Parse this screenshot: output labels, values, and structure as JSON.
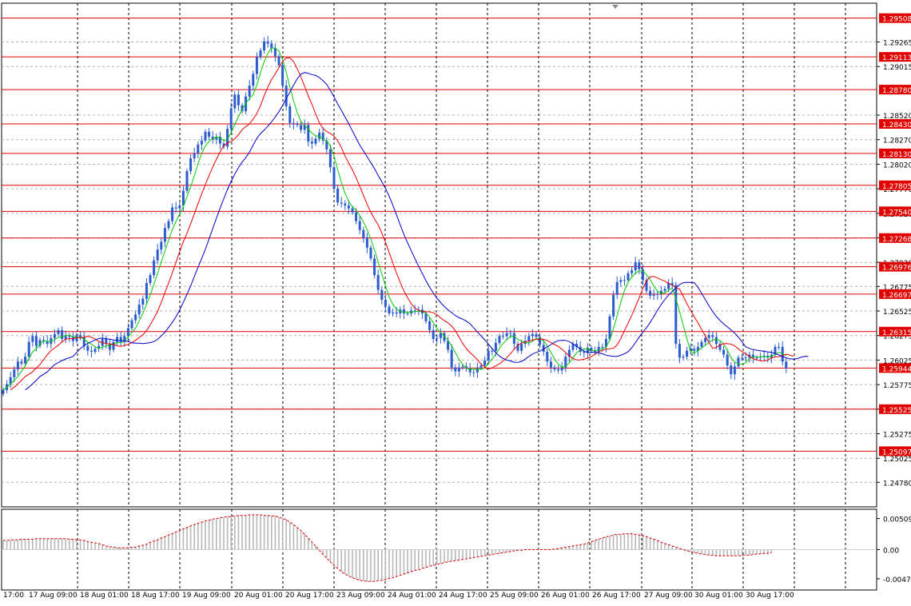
{
  "chart_data": {
    "type": "candlestick",
    "colors": {
      "background": "#ffffff",
      "grid": "#b0b0b0",
      "candle": "#2b5ccf",
      "level_line": "#e00000",
      "level_label_bg": "#e00000",
      "level_label_text": "#ffffff",
      "ma_fast": "#00cc00",
      "ma_mid": "#ee0000",
      "ma_slow": "#0000cc",
      "osc_hist": "#b8b8b8",
      "osc_signal": "#dd0000"
    },
    "price_axis": {
      "ylim": [
        1.2453,
        1.2966
      ],
      "ticks": [
        "1.29265",
        "1.29015",
        "1.28520",
        "1.28270",
        "1.28020",
        "1.27770",
        "1.27520",
        "1.27270",
        "1.27020",
        "1.26775",
        "1.26525",
        "1.26275",
        "1.26025",
        "1.25775",
        "1.25525",
        "1.25275",
        "1.25025",
        "1.24780"
      ]
    },
    "levels": [
      "1.29508",
      "1.29113",
      "1.28780",
      "1.28430",
      "1.28130",
      "1.27805",
      "1.27540",
      "1.27268",
      "1.26976",
      "1.26697",
      "1.26315",
      "1.25944",
      "1.25525",
      "1.25097"
    ],
    "time_axis": {
      "labels": [
        "17:00",
        "17 Aug 09:00",
        "18 Aug 01:00",
        "18 Aug 17:00",
        "19 Aug 09:00",
        "20 Aug 01:00",
        "20 Aug 17:00",
        "23 Aug 09:00",
        "24 Aug 01:00",
        "24 Aug 17:00",
        "25 Aug 09:00",
        "26 Aug 01:00",
        "26 Aug 17:00",
        "27 Aug 09:00",
        "30 Aug 01:00",
        "30 Aug 17:00"
      ]
    },
    "series": [
      {
        "name": "price",
        "close": [
          1.2572,
          1.2578,
          1.2585,
          1.2593,
          1.2601,
          1.2599,
          1.2606,
          1.2621,
          1.2627,
          1.2617,
          1.2623,
          1.2622,
          1.2619,
          1.2625,
          1.2629,
          1.2633,
          1.2624,
          1.2627,
          1.2626,
          1.2622,
          1.2628,
          1.2626,
          1.2617,
          1.2612,
          1.2611,
          1.2614,
          1.2617,
          1.2624,
          1.2619,
          1.2613,
          1.2621,
          1.2626,
          1.2621,
          1.2627,
          1.2635,
          1.2643,
          1.2649,
          1.2659,
          1.2665,
          1.2681,
          1.2689,
          1.2704,
          1.2715,
          1.2723,
          1.2737,
          1.2744,
          1.2758,
          1.2757,
          1.276,
          1.2775,
          1.2795,
          1.2808,
          1.2813,
          1.2822,
          1.2826,
          1.2835,
          1.283,
          1.2827,
          1.283,
          1.2823,
          1.282,
          1.2838,
          1.2859,
          1.2873,
          1.2862,
          1.2856,
          1.2871,
          1.2882,
          1.2894,
          1.2911,
          1.2918,
          1.2927,
          1.2925,
          1.292,
          1.2912,
          1.2903,
          1.2882,
          1.2861,
          1.2844,
          1.2843,
          1.2842,
          1.2837,
          1.2842,
          1.2825,
          1.2823,
          1.2828,
          1.2834,
          1.2826,
          1.2817,
          1.2799,
          1.2777,
          1.2763,
          1.2762,
          1.276,
          1.2757,
          1.2753,
          1.2744,
          1.2735,
          1.2727,
          1.2717,
          1.2706,
          1.2689,
          1.2674,
          1.2664,
          1.2657,
          1.265,
          1.2651,
          1.265,
          1.2654,
          1.265,
          1.265,
          1.2653,
          1.2653,
          1.2654,
          1.265,
          1.2642,
          1.2633,
          1.2624,
          1.2625,
          1.263,
          1.2622,
          1.2613,
          1.2595,
          1.2591,
          1.2595,
          1.2596,
          1.2594,
          1.259,
          1.259,
          1.2595,
          1.2597,
          1.2602,
          1.2612,
          1.2612,
          1.262,
          1.2627,
          1.2627,
          1.263,
          1.263,
          1.2619,
          1.2612,
          1.2619,
          1.2622,
          1.2627,
          1.2629,
          1.2626,
          1.2618,
          1.2611,
          1.2601,
          1.2595,
          1.2593,
          1.2592,
          1.2595,
          1.2606,
          1.2613,
          1.2619,
          1.2616,
          1.2611,
          1.261,
          1.2615,
          1.2612,
          1.2611,
          1.2616,
          1.2616,
          1.2624,
          1.2647,
          1.2669,
          1.2682,
          1.2684,
          1.2684,
          1.2691,
          1.2694,
          1.2702,
          1.2695,
          1.2684,
          1.2673,
          1.2668,
          1.2669,
          1.267,
          1.2673,
          1.2675,
          1.2681,
          1.2679,
          1.2619,
          1.2605,
          1.2606,
          1.2612,
          1.2614,
          1.2612,
          1.2616,
          1.2621,
          1.2625,
          1.2628,
          1.2626,
          1.2619,
          1.2613,
          1.2608,
          1.2597,
          1.2588,
          1.2596,
          1.2605,
          1.2605,
          1.2605,
          1.2608,
          1.2605,
          1.2605,
          1.2606,
          1.2607,
          1.2605,
          1.2608,
          1.2616,
          1.2616,
          1.2601,
          1.2594
        ]
      },
      {
        "name": "ma_fast"
      },
      {
        "name": "ma_mid"
      },
      {
        "name": "ma_slow"
      }
    ],
    "oscillator": {
      "ylim": [
        -0.0066,
        0.0066
      ],
      "ticks": [
        "0.00509",
        "0.00",
        "-0.00476"
      ],
      "values": [
        0.0015,
        0.0015,
        0.0016,
        0.0016,
        0.0016,
        0.0017,
        0.0017,
        0.0017,
        0.0017,
        0.0018,
        0.0018,
        0.0018,
        0.0018,
        0.0018,
        0.0018,
        0.0018,
        0.0018,
        0.0018,
        0.0017,
        0.0017,
        0.0016,
        0.0016,
        0.0015,
        0.0013,
        0.0012,
        0.0011,
        0.001,
        0.0008,
        0.0006,
        0.0005,
        0.0004,
        0.0003,
        0.0003,
        0.0003,
        0.0003,
        0.0004,
        0.0004,
        0.0006,
        0.0007,
        0.0009,
        0.0012,
        0.0014,
        0.0016,
        0.0019,
        0.0021,
        0.0024,
        0.0026,
        0.0029,
        0.0031,
        0.0034,
        0.0036,
        0.0039,
        0.0041,
        0.0043,
        0.0045,
        0.0047,
        0.0048,
        0.005,
        0.0051,
        0.0052,
        0.0053,
        0.0054,
        0.0054,
        0.0055,
        0.0056,
        0.0056,
        0.0056,
        0.0057,
        0.0057,
        0.0057,
        0.0057,
        0.0056,
        0.0056,
        0.0055,
        0.0055,
        0.0053,
        0.0051,
        0.0049,
        0.0045,
        0.0041,
        0.0036,
        0.0031,
        0.0025,
        0.0019,
        0.0012,
        0.0006,
        -0.0001,
        -0.0008,
        -0.0014,
        -0.002,
        -0.0026,
        -0.0031,
        -0.0036,
        -0.004,
        -0.0043,
        -0.0046,
        -0.0048,
        -0.005,
        -0.0051,
        -0.0052,
        -0.0052,
        -0.0052,
        -0.0051,
        -0.005,
        -0.0049,
        -0.0047,
        -0.0046,
        -0.0044,
        -0.0042,
        -0.004,
        -0.0038,
        -0.0036,
        -0.0034,
        -0.0033,
        -0.0031,
        -0.0029,
        -0.0027,
        -0.0026,
        -0.0024,
        -0.0023,
        -0.0021,
        -0.002,
        -0.0019,
        -0.0018,
        -0.0017,
        -0.0016,
        -0.0015,
        -0.0014,
        -0.0013,
        -0.0012,
        -0.0011,
        -0.001,
        -0.0009,
        -0.0008,
        -0.0007,
        -0.0006,
        -0.0005,
        -0.0004,
        -0.0003,
        -0.0002,
        -0.0001,
        -0.0001,
        0.0,
        0.0,
        0.0,
        0.0,
        0.0,
        0.0,
        0.0,
        0.0,
        0.0001,
        0.0002,
        0.0003,
        0.0004,
        0.0005,
        0.0006,
        0.0007,
        0.0008,
        0.0009,
        0.0011,
        0.0013,
        0.0015,
        0.0017,
        0.0019,
        0.0021,
        0.0022,
        0.0024,
        0.0025,
        0.0025,
        0.0026,
        0.0026,
        0.0026,
        0.0025,
        0.0024,
        0.0023,
        0.0021,
        0.0019,
        0.0017,
        0.0015,
        0.0012,
        0.001,
        0.0008,
        0.0006,
        0.0004,
        0.0002,
        0.0,
        -0.0002,
        -0.0003,
        -0.0005,
        -0.0006,
        -0.0007,
        -0.0008,
        -0.0009,
        -0.0009,
        -0.001,
        -0.001,
        -0.001,
        -0.001,
        -0.001,
        -0.001,
        -0.001,
        -0.001,
        -0.0009,
        -0.0009,
        -0.0008,
        -0.0007,
        -0.0007,
        -0.0006,
        -0.0006,
        -0.0005
      ]
    }
  }
}
